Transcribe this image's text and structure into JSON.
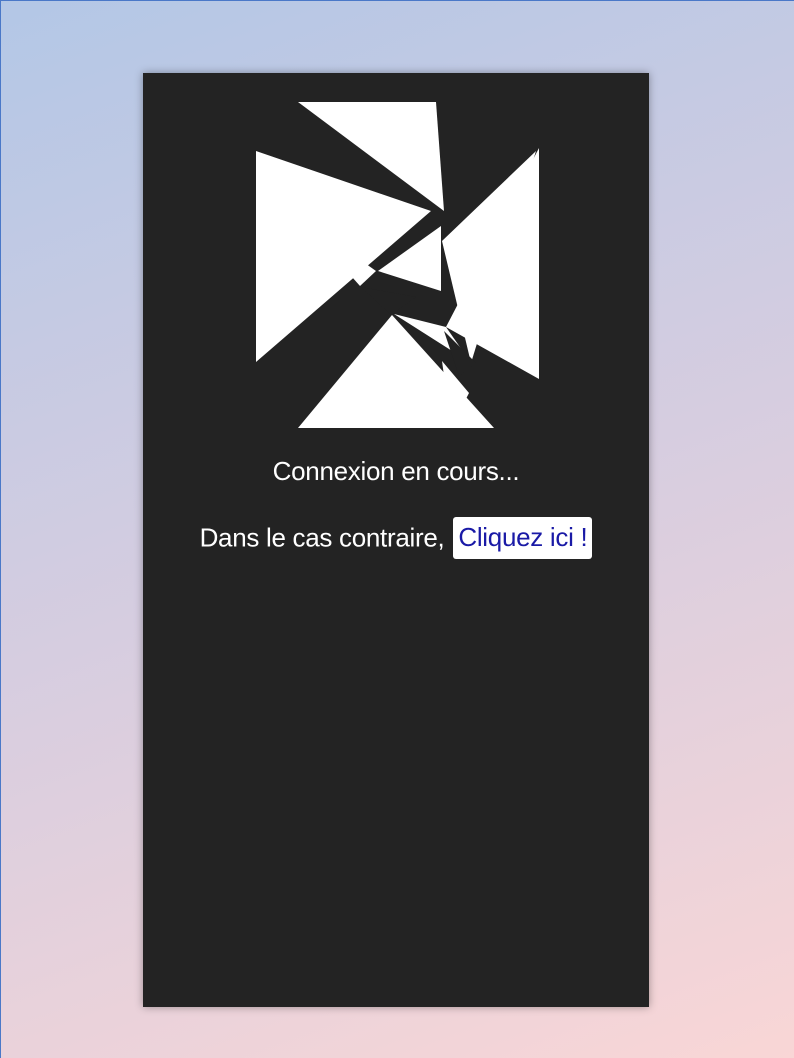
{
  "logo": {
    "icon": "abstract-geometric-logo",
    "fill_color": "#ffffff"
  },
  "status_text": "Connexion en cours...",
  "fallback": {
    "prefix": "Dans le cas contraire,",
    "link_label": "Cliquez ici !"
  },
  "colors": {
    "panel_background": "#232323",
    "text": "#ffffff",
    "link_text": "#1a1aa6"
  }
}
